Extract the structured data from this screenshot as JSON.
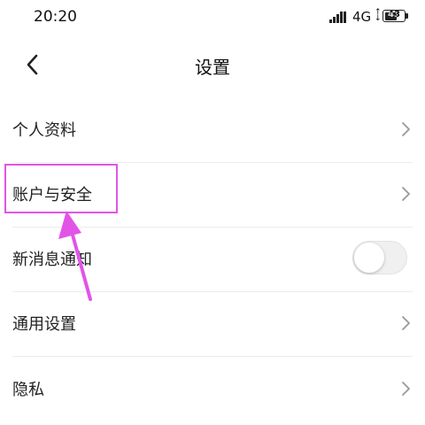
{
  "status_bar": {
    "time": "20:20",
    "network": "4G",
    "battery": "43"
  },
  "header": {
    "title": "设置",
    "back_icon": "chevron-left-icon"
  },
  "settings": [
    {
      "label": "个人资料",
      "control": "chevron-right-icon"
    },
    {
      "label": "账户与安全",
      "control": "chevron-right-icon"
    },
    {
      "label": "新消息通知",
      "control": "toggle",
      "toggle_on": false
    },
    {
      "label": "通用设置",
      "control": "chevron-right-icon"
    },
    {
      "label": "隐私",
      "control": "chevron-right-icon"
    }
  ],
  "annotation": {
    "color": "#e254e8",
    "target": "账户与安全"
  },
  "colors": {
    "background": "#ffffff",
    "divider": "#ececec",
    "chevron": "#999999"
  }
}
